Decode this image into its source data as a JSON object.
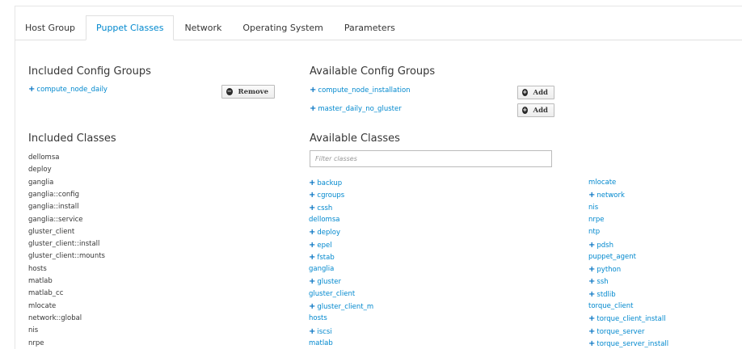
{
  "tabs": [
    "Host Group",
    "Puppet Classes",
    "Network",
    "Operating System",
    "Parameters"
  ],
  "active_tab": "Puppet Classes",
  "included_config_groups": {
    "heading": "Included Config Groups",
    "items": [
      "compute_node_daily"
    ],
    "remove_label": "Remove"
  },
  "available_config_groups": {
    "heading": "Available Config Groups",
    "items": [
      "compute_node_installation",
      "master_daily_no_gluster"
    ],
    "add_label": "Add"
  },
  "included_classes": {
    "heading": "Included Classes",
    "items": [
      "dellomsa",
      "deploy",
      "ganglia",
      "ganglia::config",
      "ganglia::install",
      "ganglia::service",
      "gluster_client",
      "gluster_client::install",
      "gluster_client::mounts",
      "hosts",
      "matlab",
      "matlab_cc",
      "mlocate",
      "network::global",
      "nis",
      "nrpe"
    ]
  },
  "available_classes": {
    "heading": "Available Classes",
    "filter_placeholder": "Filter classes",
    "col1": [
      {
        "label": "backup",
        "plus": true
      },
      {
        "label": "cgroups",
        "plus": true
      },
      {
        "label": "cssh",
        "plus": true
      },
      {
        "label": "dellomsa",
        "plus": false
      },
      {
        "label": "deploy",
        "plus": true
      },
      {
        "label": "epel",
        "plus": true
      },
      {
        "label": "fstab",
        "plus": true
      },
      {
        "label": "ganglia",
        "plus": false
      },
      {
        "label": "gluster",
        "plus": true
      },
      {
        "label": "gluster_client",
        "plus": false
      },
      {
        "label": "gluster_client_m",
        "plus": true
      },
      {
        "label": "hosts",
        "plus": false
      },
      {
        "label": "iscsi",
        "plus": true
      },
      {
        "label": "matlab",
        "plus": false
      }
    ],
    "col2": [
      {
        "label": "mlocate",
        "plus": false
      },
      {
        "label": "network",
        "plus": true
      },
      {
        "label": "nis",
        "plus": false
      },
      {
        "label": "nrpe",
        "plus": false
      },
      {
        "label": "ntp",
        "plus": false
      },
      {
        "label": "pdsh",
        "plus": true
      },
      {
        "label": "puppet_agent",
        "plus": false
      },
      {
        "label": "python",
        "plus": true
      },
      {
        "label": "ssh",
        "plus": true
      },
      {
        "label": "stdlib",
        "plus": true
      },
      {
        "label": "torque_client",
        "plus": false
      },
      {
        "label": "torque_client_install",
        "plus": true
      },
      {
        "label": "torque_server",
        "plus": true
      },
      {
        "label": "torque_server_install",
        "plus": true
      }
    ]
  },
  "colors": {
    "link": "#0088ce",
    "text": "#363636"
  }
}
